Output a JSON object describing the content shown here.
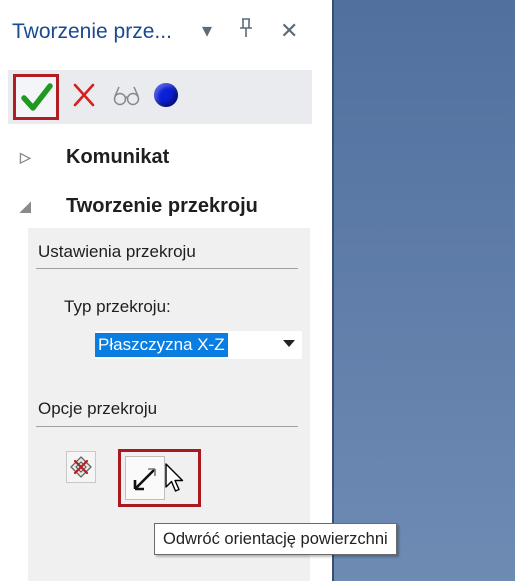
{
  "panel": {
    "title": "Tworzenie prze...",
    "title_icons": [
      "dropdown-arrow-icon",
      "pin-icon",
      "close-icon"
    ]
  },
  "toolbar": {
    "buttons": [
      "ok-checkmark-icon",
      "cancel-x-icon",
      "preview-glasses-icon",
      "blue-circle-icon"
    ],
    "colors": {
      "ok": "#1f9a1f",
      "cancel": "#d42020",
      "circle": "#0a1fd6"
    }
  },
  "sections": [
    {
      "label": "Komunikat",
      "expanded": false
    },
    {
      "label": "Tworzenie przekroju",
      "expanded": true
    }
  ],
  "settings": {
    "group_title": "Ustawienia przekroju",
    "typ_label": "Typ przekroju:",
    "typ_value": "Płaszczyzna X-Z"
  },
  "options": {
    "group_title": "Opcje przekroju",
    "buttons": [
      "section-plane-icon",
      "flip-orientation-icon"
    ]
  },
  "tooltip": "Odwróć orientację powierzchni",
  "colors": {
    "accent_title": "#1a4a90",
    "highlight_border": "#b01d23",
    "selection": "#0a7de1",
    "viewport": "#5b79a6"
  }
}
